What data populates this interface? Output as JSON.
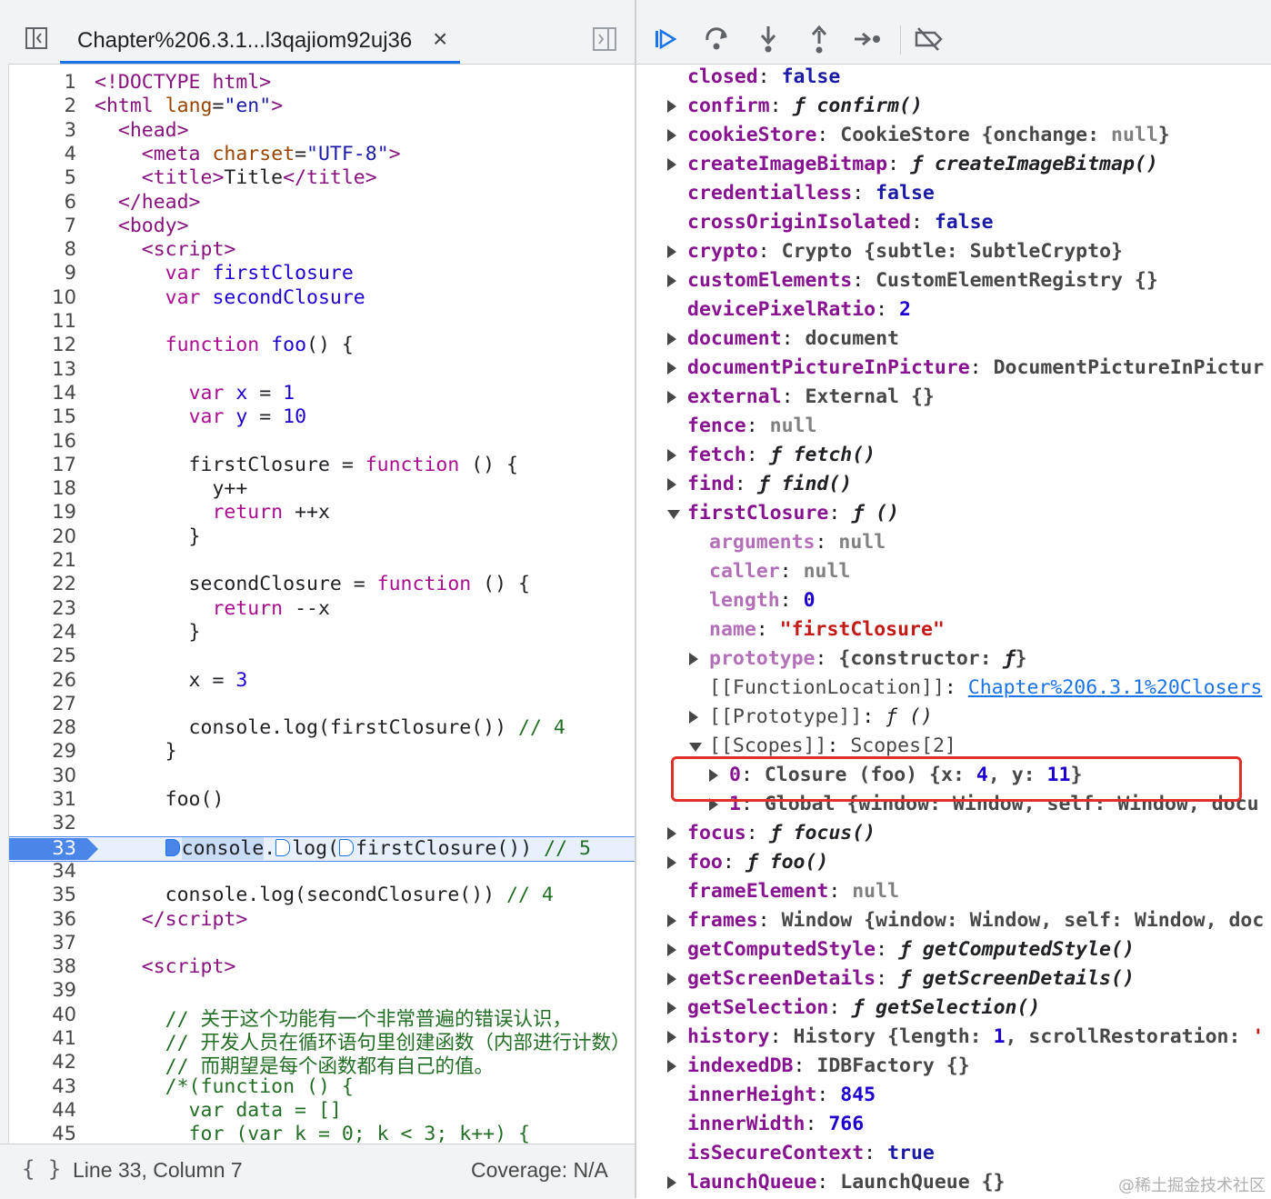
{
  "source_panel": {
    "tab_label": "Chapter%206.3.1...l3qajiom92uj36",
    "tab_close": "×",
    "status": {
      "braces": "{ }",
      "position": "Line 33, Column 7",
      "coverage": "Coverage: N/A"
    },
    "current_line": 33,
    "lines": [
      {
        "n": "1",
        "t": "<!DOCTYPE html>",
        "c": "tag"
      },
      {
        "n": "2",
        "html": "<span class='tag'>&lt;html</span> <span class='attr'>lang</span>=<span class='str'>\"en\"</span><span class='tag'>&gt;</span>"
      },
      {
        "n": "3",
        "html": "  <span class='tag'>&lt;head&gt;</span>"
      },
      {
        "n": "4",
        "html": "    <span class='tag'>&lt;meta</span> <span class='attr'>charset</span>=<span class='str'>\"UTF-8\"</span><span class='tag'>&gt;</span>"
      },
      {
        "n": "5",
        "html": "    <span class='tag'>&lt;title&gt;</span>Title<span class='tag'>&lt;/title&gt;</span>"
      },
      {
        "n": "6",
        "html": "  <span class='tag'>&lt;/head&gt;</span>"
      },
      {
        "n": "7",
        "html": "  <span class='tag'>&lt;body&gt;</span>"
      },
      {
        "n": "8",
        "html": "    <span class='tag'>&lt;script&gt;</span>"
      },
      {
        "n": "9",
        "html": "      <span class='kw'>var</span> <span class='var'>firstClosure</span>"
      },
      {
        "n": "10",
        "html": "      <span class='kw'>var</span> <span class='var'>secondClosure</span>"
      },
      {
        "n": "11",
        "html": ""
      },
      {
        "n": "12",
        "html": "      <span class='kw'>function</span> <span class='var'>foo</span>() {"
      },
      {
        "n": "13",
        "html": ""
      },
      {
        "n": "14",
        "html": "        <span class='kw'>var</span> <span class='var'>x</span> = <span class='num'>1</span>"
      },
      {
        "n": "15",
        "html": "        <span class='kw'>var</span> <span class='var'>y</span> = <span class='num'>10</span>"
      },
      {
        "n": "16",
        "html": ""
      },
      {
        "n": "17",
        "html": "        firstClosure = <span class='kw'>function</span> () {"
      },
      {
        "n": "18",
        "html": "          y++"
      },
      {
        "n": "19",
        "html": "          <span class='kw'>return</span> ++x"
      },
      {
        "n": "20",
        "html": "        }"
      },
      {
        "n": "21",
        "html": ""
      },
      {
        "n": "22",
        "html": "        secondClosure = <span class='kw'>function</span> () {"
      },
      {
        "n": "23",
        "html": "          <span class='kw'>return</span> --x"
      },
      {
        "n": "24",
        "html": "        }"
      },
      {
        "n": "25",
        "html": ""
      },
      {
        "n": "26",
        "html": "        x = <span class='num'>3</span>"
      },
      {
        "n": "27",
        "html": ""
      },
      {
        "n": "28",
        "html": "        console.log(firstClosure()) <span class='cmt'>// 4</span>"
      },
      {
        "n": "29",
        "html": "      }"
      },
      {
        "n": "30",
        "html": ""
      },
      {
        "n": "31",
        "html": "      foo()"
      },
      {
        "n": "32",
        "html": ""
      },
      {
        "n": "33",
        "html": "      <span class='mk filled'></span><span class='hl'>console</span>.<span class='mk'></span>log(<span class='mk'></span>firstClosure()) <span class='cmt'>// 5</span>",
        "exec": true
      },
      {
        "n": "34",
        "html": ""
      },
      {
        "n": "35",
        "html": "      console.log(secondClosure()) <span class='cmt'>// 4</span>"
      },
      {
        "n": "36",
        "html": "    <span class='tag'>&lt;/script&gt;</span>"
      },
      {
        "n": "37",
        "html": ""
      },
      {
        "n": "38",
        "html": "    <span class='tag'>&lt;script&gt;</span>"
      },
      {
        "n": "39",
        "html": ""
      },
      {
        "n": "40",
        "html": "      <span class='cmt'>// 关于这个功能有一个非常普遍的错误认识，</span>"
      },
      {
        "n": "41",
        "html": "      <span class='cmt'>// 开发人员在循环语句里创建函数（内部进行计数）</span>"
      },
      {
        "n": "42",
        "html": "      <span class='cmt'>// 而期望是每个函数都有自己的值。</span>"
      },
      {
        "n": "43",
        "html": "      <span class='cmt'>/*(function () {</span>"
      },
      {
        "n": "44",
        "html": "<span class='cmt'>        var data = []</span>"
      },
      {
        "n": "45",
        "html": "<span class='cmt'>        for (var k = 0; k &lt; 3; k++) {</span>"
      }
    ]
  },
  "debugger_toolbar": [
    "resume-icon",
    "step-over-icon",
    "step-into-icon",
    "step-out-icon",
    "step-icon",
    "deactivate-breakpoints-icon"
  ],
  "scope_properties": [
    {
      "indent": 0,
      "arrow": "none",
      "key": "closed",
      "val": "<span class='b'>false</span>"
    },
    {
      "indent": 0,
      "arrow": "right",
      "key": "confirm",
      "val": "<span class='f'>ƒ confirm()</span>"
    },
    {
      "indent": 0,
      "arrow": "right",
      "key": "cookieStore",
      "val": "CookieStore {<span class='k'>onchange</span>: <span class='nul'>null</span>}"
    },
    {
      "indent": 0,
      "arrow": "right",
      "key": "createImageBitmap",
      "val": "<span class='f'>ƒ createImageBitmap()</span>"
    },
    {
      "indent": 0,
      "arrow": "none",
      "key": "credentialless",
      "val": "<span class='b'>false</span>"
    },
    {
      "indent": 0,
      "arrow": "none",
      "key": "crossOriginIsolated",
      "val": "<span class='b'>false</span>"
    },
    {
      "indent": 0,
      "arrow": "right",
      "key": "crypto",
      "val": "Crypto {<span class='k'>subtle</span>: SubtleCrypto}"
    },
    {
      "indent": 0,
      "arrow": "right",
      "key": "customElements",
      "val": "CustomElementRegistry {}"
    },
    {
      "indent": 0,
      "arrow": "none",
      "key": "devicePixelRatio",
      "val": "<span class='n'>2</span>"
    },
    {
      "indent": 0,
      "arrow": "right",
      "key": "document",
      "val": "document"
    },
    {
      "indent": 0,
      "arrow": "right",
      "key": "documentPictureInPicture",
      "val": "DocumentPictureInPictur"
    },
    {
      "indent": 0,
      "arrow": "right",
      "key": "external",
      "val": "External {}"
    },
    {
      "indent": 0,
      "arrow": "none",
      "key": "fence",
      "val": "<span class='nul'>null</span>"
    },
    {
      "indent": 0,
      "arrow": "right",
      "key": "fetch",
      "val": "<span class='f'>ƒ fetch()</span>"
    },
    {
      "indent": 0,
      "arrow": "right",
      "key": "find",
      "val": "<span class='f'>ƒ find()</span>"
    },
    {
      "indent": 0,
      "arrow": "down",
      "key": "firstClosure",
      "val": "<span class='f'>ƒ ()</span>"
    },
    {
      "indent": 1,
      "arrow": "none",
      "key": "arguments",
      "dim": true,
      "val": "<span class='nul'>null</span>"
    },
    {
      "indent": 1,
      "arrow": "none",
      "key": "caller",
      "dim": true,
      "val": "<span class='nul'>null</span>"
    },
    {
      "indent": 1,
      "arrow": "none",
      "key": "length",
      "dim": true,
      "val": "<span class='n'>0</span>"
    },
    {
      "indent": 1,
      "arrow": "none",
      "key": "name",
      "dim": true,
      "val": "<span class='s'>\"firstClosure\"</span>"
    },
    {
      "indent": 1,
      "arrow": "right",
      "key": "prototype",
      "dim": true,
      "val": "{<span class='k'>constructor</span>: <span class='f'>ƒ</span>}"
    },
    {
      "indent": 1,
      "arrow": "none",
      "key": "[[FunctionLocation]]",
      "int": true,
      "val": "<span class='link'>Chapter%206.3.1%20Closers</span>"
    },
    {
      "indent": 1,
      "arrow": "right",
      "key": "[[Prototype]]",
      "int": true,
      "val": "<span class='f'>ƒ ()</span>"
    },
    {
      "indent": 1,
      "arrow": "down",
      "key": "[[Scopes]]",
      "int": true,
      "val": "Scopes[2]"
    },
    {
      "indent": 2,
      "arrow": "right",
      "key": "0",
      "val": "Closure (foo) {<span class='k'>x</span>: <span class='n'>4</span>, <span class='k'>y</span>: <span class='n'>11</span>}"
    },
    {
      "indent": 2,
      "arrow": "right",
      "key": "1",
      "val": "Global {<span class='k'>window</span>: Window, <span class='k'>self</span>: Window, docu"
    },
    {
      "indent": 0,
      "arrow": "right",
      "key": "focus",
      "val": "<span class='f'>ƒ focus()</span>"
    },
    {
      "indent": 0,
      "arrow": "right",
      "key": "foo",
      "val": "<span class='f'>ƒ foo()</span>"
    },
    {
      "indent": 0,
      "arrow": "none",
      "key": "frameElement",
      "val": "<span class='nul'>null</span>"
    },
    {
      "indent": 0,
      "arrow": "right",
      "key": "frames",
      "val": "Window {<span class='k'>window</span>: Window, <span class='k'>self</span>: Window, doc"
    },
    {
      "indent": 0,
      "arrow": "right",
      "key": "getComputedStyle",
      "val": "<span class='f'>ƒ getComputedStyle()</span>"
    },
    {
      "indent": 0,
      "arrow": "right",
      "key": "getScreenDetails",
      "val": "<span class='f'>ƒ getScreenDetails()</span>"
    },
    {
      "indent": 0,
      "arrow": "right",
      "key": "getSelection",
      "val": "<span class='f'>ƒ getSelection()</span>"
    },
    {
      "indent": 0,
      "arrow": "right",
      "key": "history",
      "val": "History {<span class='k'>length</span>: <span class='n'>1</span>, <span class='k'>scrollRestoration</span>: <span class='s'>'</span>"
    },
    {
      "indent": 0,
      "arrow": "right",
      "key": "indexedDB",
      "val": "IDBFactory {}"
    },
    {
      "indent": 0,
      "arrow": "none",
      "key": "innerHeight",
      "val": "<span class='n'>845</span>"
    },
    {
      "indent": 0,
      "arrow": "none",
      "key": "innerWidth",
      "val": "<span class='n'>766</span>"
    },
    {
      "indent": 0,
      "arrow": "none",
      "key": "isSecureContext",
      "val": "<span class='b'>true</span>"
    },
    {
      "indent": 0,
      "arrow": "right",
      "key": "launchQueue",
      "val": "LaunchQueue {}"
    }
  ],
  "watermark": "@稀土掘金技术社区",
  "colors": {
    "accent": "#1a73e8",
    "highlight_box": "#e0312c",
    "exec_line": "#e8f0fe"
  }
}
